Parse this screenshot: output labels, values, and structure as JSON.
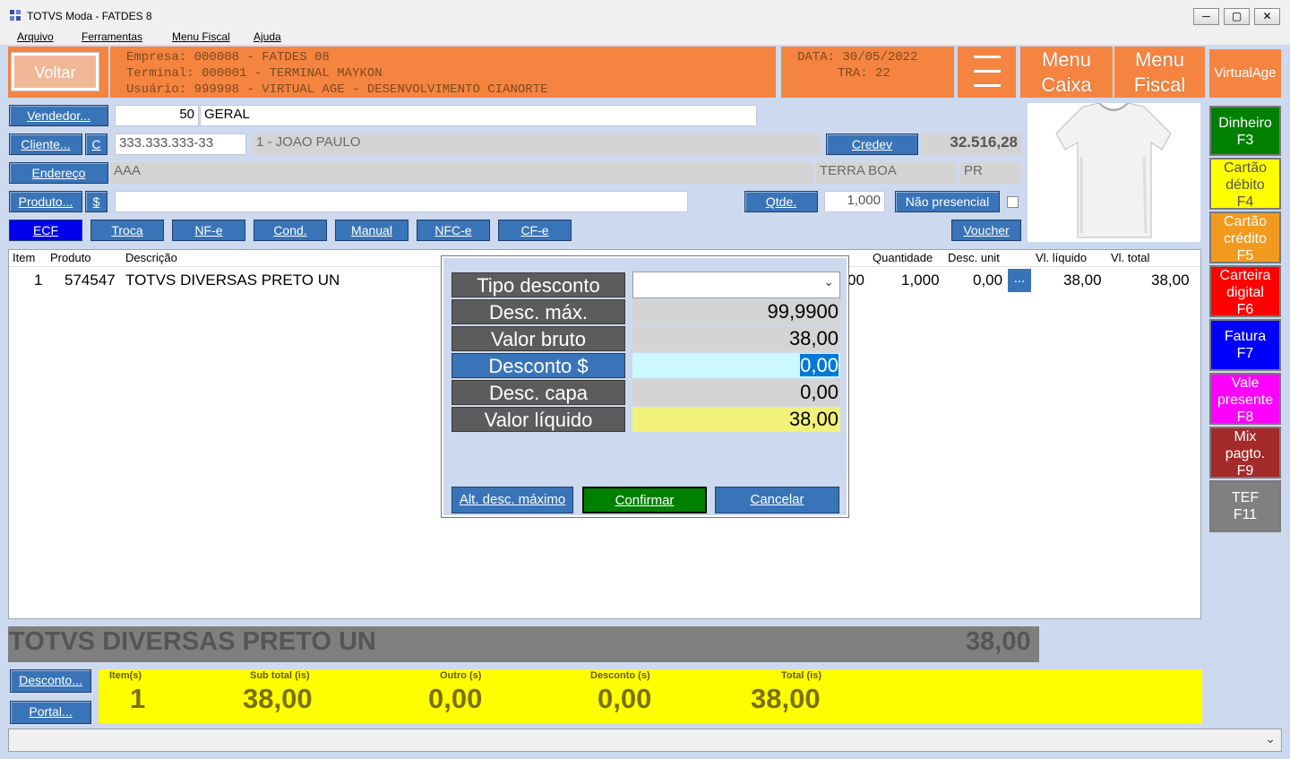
{
  "window": {
    "title": "TOTVS Moda - FATDES 8",
    "min": "─",
    "max": "▢",
    "close": "✕"
  },
  "menu": {
    "items": [
      "Arquivo",
      "Ferramentas",
      "Menu Fiscal",
      "Ajuda"
    ]
  },
  "header": {
    "back_label": "Voltar",
    "empresa": "Empresa: 000008 - FATDES 08",
    "terminal": "Terminal: 000001 - TERMINAL MAYKON",
    "usuario": "Usuário: 999998 - VIRTUAL AGE - DESENVOLVIMENTO CIANORTE",
    "data": "DATA: 30/05/2022",
    "tra": "TRA: 22",
    "menu_caixa_1": "Menu",
    "menu_caixa_2": "Caixa",
    "menu_fiscal_1": "Menu",
    "menu_fiscal_2": "Fiscal",
    "virtualage": "VirtualAge"
  },
  "form": {
    "vendedor_label": "Vendedor...",
    "vendedor_code": "50",
    "vendedor_name": "GERAL",
    "cliente_label": "Cliente...",
    "cliente_c": "C",
    "cliente_cpf": "333.333.333-33",
    "cliente_name": "1 - JOAO PAULO",
    "credev_label": "Credev",
    "credev_value": "32.516,28",
    "endereco_label": "Endereço",
    "endereco_value": "AAA",
    "cidade": "TERRA BOA",
    "uf": "PR",
    "produto_label": "Produto...",
    "produto_dollar": "$",
    "qtde_label": "Qtde.",
    "qtde_value": "1,000",
    "nao_presencial": "Não presencial",
    "tabs": [
      "ECF",
      "Troca",
      "NF-e",
      "Cond.",
      "Manual",
      "NFC-e",
      "CF-e"
    ],
    "voucher": "Voucher"
  },
  "grid": {
    "headers": {
      "item": "Item",
      "produto": "Produto",
      "descricao": "Descrição",
      "quantidade": "Quantidade",
      "desc_unit": "Desc. unit",
      "vl_liquido": "Vl. líquido",
      "vl_total": "Vl. total"
    },
    "row": {
      "item": "1",
      "produto": "574547",
      "descricao": "TOTVS DIVERSAS PRETO UN",
      "hidden_val": "00",
      "quantidade": "1,000",
      "desc_unit": "0,00",
      "more": "...",
      "vl_liquido": "38,00",
      "vl_total": "38,00"
    }
  },
  "payments": [
    {
      "l1": "Dinheiro",
      "l2": "F3"
    },
    {
      "l1": "Cartão",
      "l2": "débito",
      "l3": "F4"
    },
    {
      "l1": "Cartão",
      "l2": "crédito",
      "l3": "F5"
    },
    {
      "l1": "Carteira",
      "l2": "digital",
      "l3": "F6"
    },
    {
      "l1": "Fatura",
      "l2": "F7"
    },
    {
      "l1": "Vale",
      "l2": "presente",
      "l3": "F8"
    },
    {
      "l1": "Mix",
      "l2": "pagto.",
      "l3": "F9"
    },
    {
      "l1": "TEF",
      "l2": "F11"
    }
  ],
  "dialog": {
    "tipo_desconto_label": "Tipo desconto",
    "tipo_desconto_value": "",
    "chevron": "⌄",
    "desc_max_label": "Desc. máx.",
    "desc_max_value": "99,9900",
    "valor_bruto_label": "Valor bruto",
    "valor_bruto_value": "38,00",
    "desconto_label": "Desconto $",
    "desconto_value": "0,00",
    "desc_capa_label": "Desc. capa",
    "desc_capa_value": "0,00",
    "valor_liquido_label": "Valor líquido",
    "valor_liquido_value": "38,00",
    "alt_btn": "Alt. desc. máximo",
    "confirm_btn": "Confirmar",
    "cancel_btn": "Cancelar"
  },
  "bottom": {
    "product_name": "TOTVS DIVERSAS PRETO UN",
    "product_total": "38,00",
    "desconto_btn": "Desconto...",
    "portal_btn": "Portal...",
    "item_label": "Item(s)",
    "item_value": "1",
    "subtotal_label": "Sub total (is)",
    "subtotal_value": "38,00",
    "outro_label": "Outro (s)",
    "outro_value": "0,00",
    "desconto_label": "Desconto (s)",
    "desconto_value": "0,00",
    "total_label": "Total (is)",
    "total_value": "38,00"
  },
  "statusbar": {
    "chevron": "⌄"
  }
}
